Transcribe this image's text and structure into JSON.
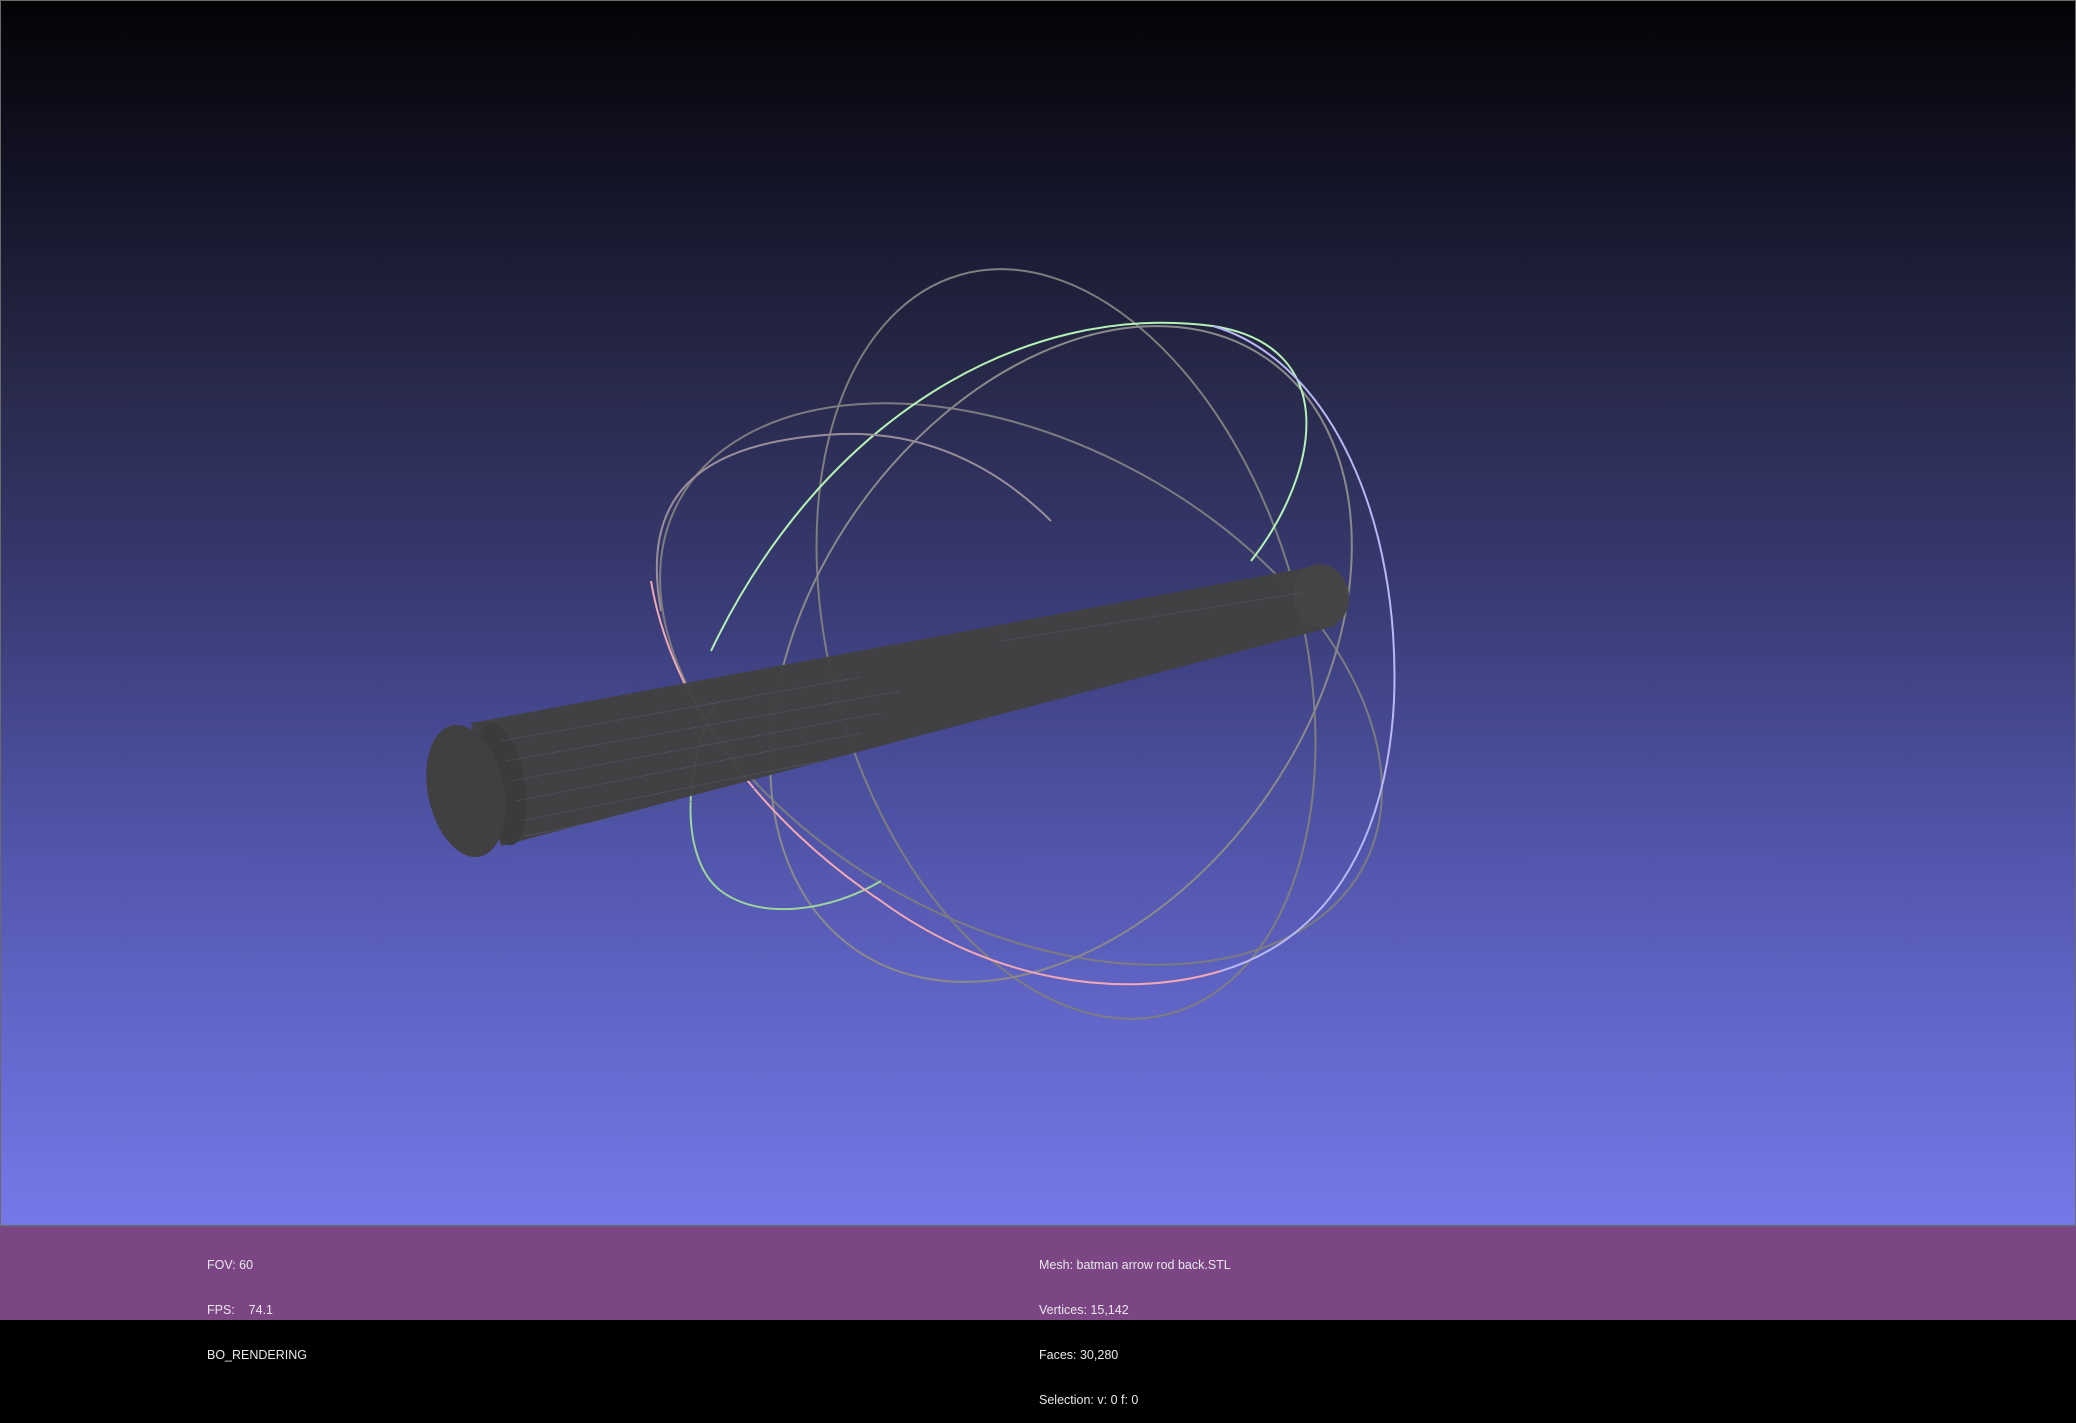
{
  "viewport": {
    "background_top": "#030306",
    "background_bottom": "#7678ea"
  },
  "scene": {
    "mesh_color": "#414141",
    "trackball_colors": {
      "red_ring": "#f0a0b0",
      "green_ring": "#b0f0b0",
      "blue_ring": "#b0b0f4",
      "gray_ring": "#8a8a8a"
    }
  },
  "status_left": {
    "fov": "FOV: 60",
    "fps": "FPS:    74.1",
    "mode": "BO_RENDERING"
  },
  "status_right": {
    "mesh": "Mesh: batman arrow rod back.STL",
    "vertices": "Vertices: 15,142",
    "faces": "Faces: 30,280",
    "selection": "Selection: v: 0 f: 0"
  },
  "info_bar_color": "#7b4683"
}
